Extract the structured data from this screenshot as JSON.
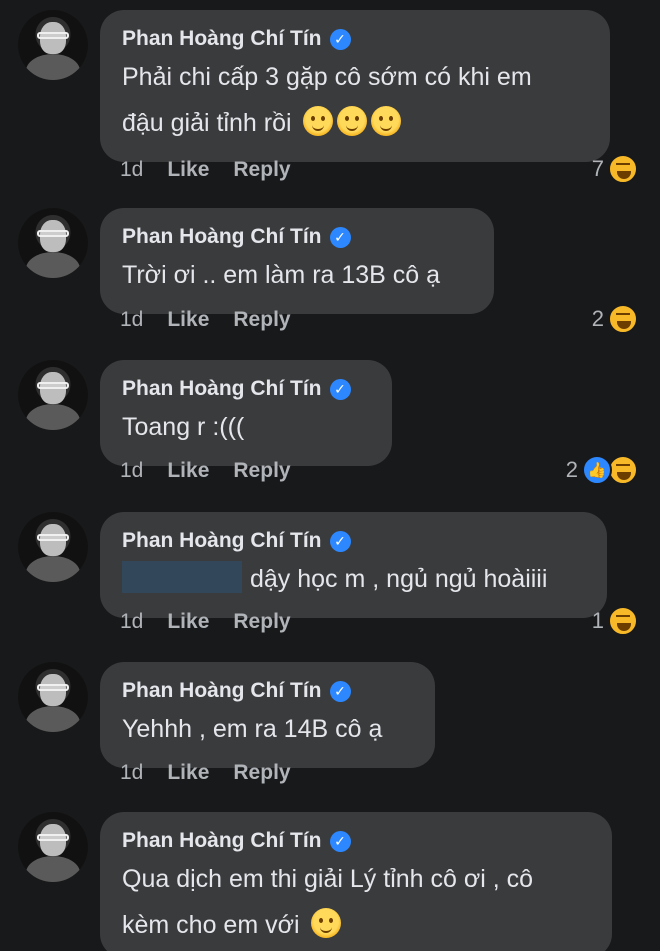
{
  "comments": [
    {
      "author": "Phan Hoàng Chí Tín",
      "lines": [
        "Phải chi cấp 3 gặp cô sớm có khi em",
        "đậu giải tỉnh rồi"
      ],
      "trailing_emoji": [
        "slightly-smiling-face-icon",
        "slightly-smiling-face-icon",
        "slightly-smiling-face-icon"
      ],
      "time": "1d",
      "like": "Like",
      "reply": "Reply",
      "reaction_count": "7",
      "reactions": [
        "haha-icon"
      ]
    },
    {
      "author": "Phan Hoàng Chí Tín",
      "lines": [
        "Trời ơi .. em làm ra 13B cô ạ"
      ],
      "time": "1d",
      "like": "Like",
      "reply": "Reply",
      "reaction_count": "2",
      "reactions": [
        "haha-icon"
      ]
    },
    {
      "author": "Phan Hoàng Chí Tín",
      "lines": [
        "Toang r :((("
      ],
      "time": "1d",
      "like": "Like",
      "reply": "Reply",
      "reaction_count": "2",
      "reactions": [
        "like-icon",
        "haha-icon"
      ]
    },
    {
      "author": "Phan Hoàng Chí Tín",
      "lines": [
        "dậy học m , ngủ ngủ hoàiiii"
      ],
      "mention_redacted": true,
      "time": "1d",
      "like": "Like",
      "reply": "Reply",
      "reaction_count": "1",
      "reactions": [
        "haha-icon"
      ]
    },
    {
      "author": "Phan Hoàng Chí Tín",
      "lines": [
        "Yehhh , em ra 14B cô ạ"
      ],
      "time": "1d",
      "like": "Like",
      "reply": "Reply"
    },
    {
      "author": "Phan Hoàng Chí Tín",
      "lines": [
        "Qua dịch em thi giải Lý tỉnh cô ơi , cô",
        "kèm cho em với"
      ],
      "trailing_emoji": [
        "slightly-smiling-face-icon"
      ]
    }
  ],
  "colors": {
    "background": "#18191a",
    "bubble": "#3a3b3c",
    "verified": "#2d88ff",
    "secondary_text": "#b0b3b8"
  }
}
